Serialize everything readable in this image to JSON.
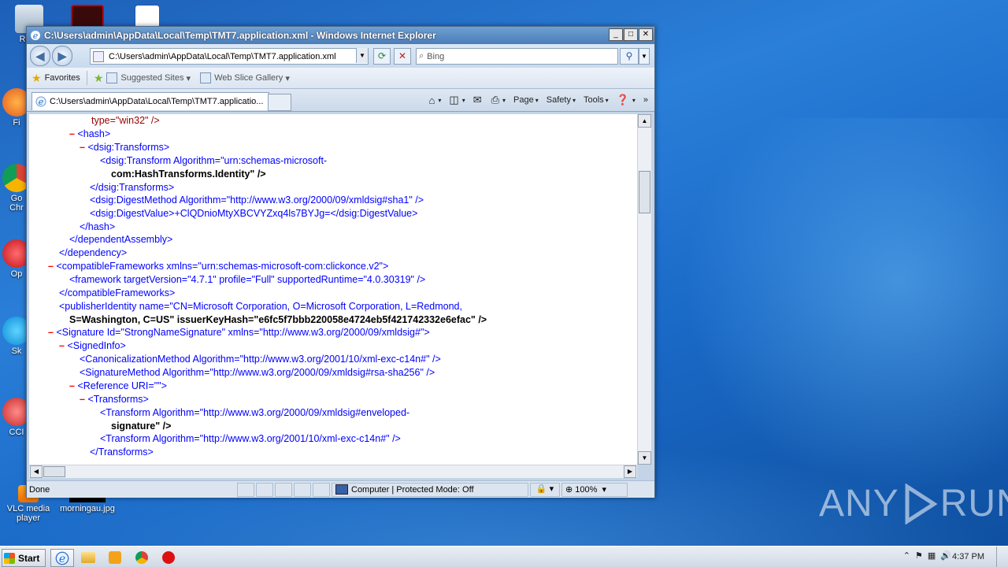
{
  "window": {
    "title": "C:\\Users\\admin\\AppData\\Local\\Temp\\TMT7.application.xml - Windows Internet Explorer",
    "address": "C:\\Users\\admin\\AppData\\Local\\Temp\\TMT7.application.xml",
    "search_placeholder": "Bing",
    "tab_label": "C:\\Users\\admin\\AppData\\Local\\Temp\\TMT7.applicatio...",
    "status_text": "Done",
    "zone_text": "Computer | Protected Mode: Off",
    "zoom": "100%"
  },
  "favorites_bar": {
    "favorites_label": "Favorites",
    "suggested_sites": "Suggested Sites",
    "web_slice_gallery": "Web Slice Gallery"
  },
  "command_bar": {
    "page": "Page",
    "safety": "Safety",
    "tools": "Tools"
  },
  "desktop": {
    "icons": [
      "Recy",
      "Fi",
      "Go",
      "Chr",
      "Op",
      "Sk",
      "CCI",
      "VLC media",
      "player",
      "morningau.jpg"
    ]
  },
  "xml_lines": {
    "l1": "type=\"win32\" />",
    "l2": "<hash>",
    "l3": "<dsig:Transforms>",
    "l4a": "<dsig:Transform Algorithm=\"urn:schemas-microsoft-",
    "l4b": "com:HashTransforms.Identity\" />",
    "l5": "</dsig:Transforms>",
    "l6": "<dsig:DigestMethod Algorithm=\"http://www.w3.org/2000/09/xmldsig#sha1\" />",
    "l7": "<dsig:DigestValue>+ClQDnioMtyXBCVYZxq4ls7BYJg=</dsig:DigestValue>",
    "l8": "</hash>",
    "l9": "</dependentAssembly>",
    "l10": "</dependency>",
    "l11": "<compatibleFrameworks xmlns=\"urn:schemas-microsoft-com:clickonce.v2\">",
    "l12": "<framework targetVersion=\"4.7.1\" profile=\"Full\" supportedRuntime=\"4.0.30319\" />",
    "l13": "</compatibleFrameworks>",
    "l14a": "<publisherIdentity name=\"CN=Microsoft Corporation, O=Microsoft Corporation, L=Redmond,",
    "l14b": "S=Washington, C=US\" issuerKeyHash=\"e6fc5f7bbb220058e4724eb5f421742332e6efac\" />",
    "l15": "<Signature Id=\"StrongNameSignature\" xmlns=\"http://www.w3.org/2000/09/xmldsig#\">",
    "l16": "<SignedInfo>",
    "l17": "<CanonicalizationMethod Algorithm=\"http://www.w3.org/2001/10/xml-exc-c14n#\" />",
    "l18": "<SignatureMethod Algorithm=\"http://www.w3.org/2000/09/xmldsig#rsa-sha256\" />",
    "l19": "<Reference URI=\"\">",
    "l20": "<Transforms>",
    "l21a": "<Transform Algorithm=\"http://www.w3.org/2000/09/xmldsig#enveloped-",
    "l21b": "signature\" />",
    "l22": "<Transform Algorithm=\"http://www.w3.org/2001/10/xml-exc-c14n#\" />",
    "l23": "</Transforms>"
  },
  "taskbar": {
    "start_label": "Start",
    "clock": "4:37 PM"
  },
  "watermark": {
    "left": "ANY",
    "right": "RUN"
  }
}
